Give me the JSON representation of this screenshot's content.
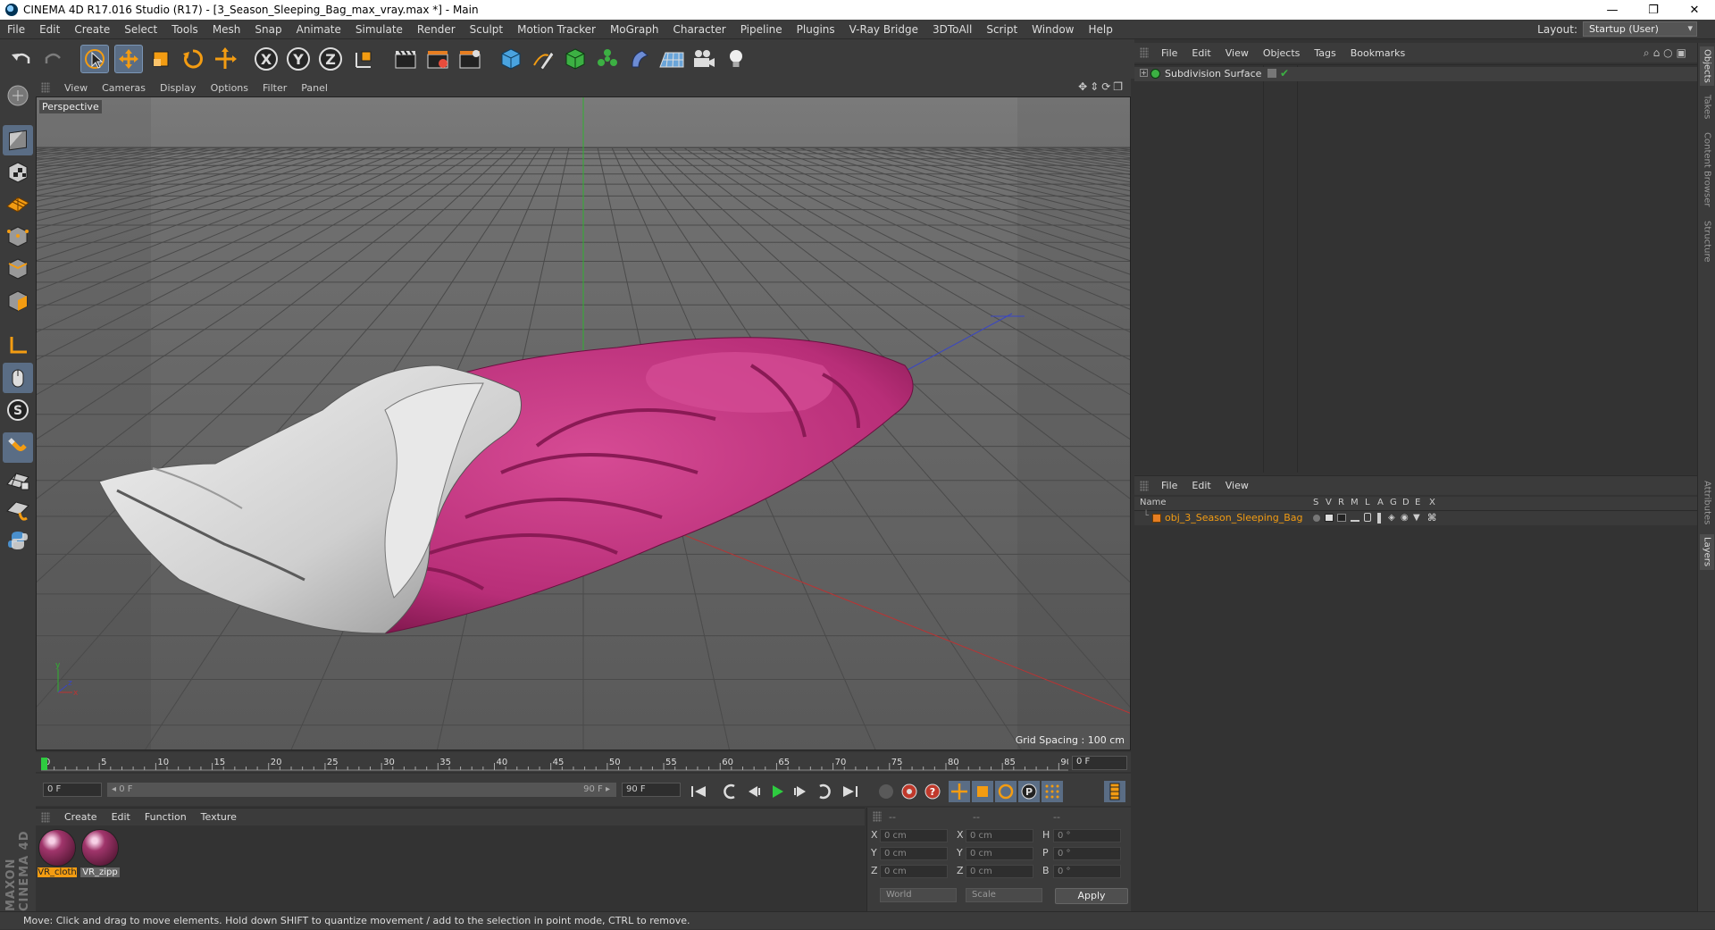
{
  "window": {
    "title": "CINEMA 4D R17.016 Studio (R17) - [3_Season_Sleeping_Bag_max_vray.max *] - Main",
    "controls": [
      "—",
      "❐",
      "✕"
    ]
  },
  "menubar": {
    "items": [
      "File",
      "Edit",
      "Create",
      "Select",
      "Tools",
      "Mesh",
      "Snap",
      "Animate",
      "Simulate",
      "Render",
      "Sculpt",
      "Motion Tracker",
      "MoGraph",
      "Character",
      "Pipeline",
      "Plugins",
      "V-Ray Bridge",
      "3DToAll",
      "Script",
      "Window",
      "Help"
    ],
    "layout_label": "Layout:",
    "layout_value": "Startup (User)"
  },
  "toolbar": {
    "axis_x": "X",
    "axis_y": "Y",
    "axis_z": "Z"
  },
  "viewport": {
    "menu": [
      "View",
      "Cameras",
      "Display",
      "Options",
      "Filter",
      "Panel"
    ],
    "camera_label": "Perspective",
    "grid_spacing": "Grid Spacing : 100 cm"
  },
  "timeline": {
    "ticks": [
      "0",
      "5",
      "10",
      "15",
      "20",
      "25",
      "30",
      "35",
      "40",
      "45",
      "50",
      "55",
      "60",
      "65",
      "70",
      "75",
      "80",
      "85",
      "90"
    ],
    "current_frame": "0 F",
    "start_field": "0 F",
    "range_start": "◂ 0 F",
    "range_end": "90 F ▸",
    "end_field": "90 F"
  },
  "material_panel": {
    "menu": [
      "Create",
      "Edit",
      "Function",
      "Texture"
    ],
    "materials": [
      {
        "name": "VR_cloth"
      },
      {
        "name": "VR_zipp"
      }
    ]
  },
  "coords": {
    "header": [
      "--",
      "--",
      "--"
    ],
    "rows": [
      {
        "axis": "X",
        "pos": "0 cm",
        "axis2": "X",
        "size": "0 cm",
        "rot_label": "H",
        "rot": "0 °"
      },
      {
        "axis": "Y",
        "pos": "0 cm",
        "axis2": "Y",
        "size": "0 cm",
        "rot_label": "P",
        "rot": "0 °"
      },
      {
        "axis": "Z",
        "pos": "0 cm",
        "axis2": "Z",
        "size": "0 cm",
        "rot_label": "B",
        "rot": "0 °"
      }
    ],
    "space": "World",
    "mode": "Scale",
    "apply": "Apply"
  },
  "objects_panel": {
    "menu": [
      "File",
      "Edit",
      "View",
      "Objects",
      "Tags",
      "Bookmarks"
    ],
    "object_name": "Subdivision Surface"
  },
  "layers_panel": {
    "menu": [
      "File",
      "Edit",
      "View"
    ],
    "columns": [
      "Name",
      "S",
      "V",
      "R",
      "M",
      "L",
      "A",
      "G",
      "D",
      "E",
      "X"
    ],
    "layer_name": "obj_3_Season_Sleeping_Bag"
  },
  "right_tabs": [
    "Objects",
    "Takes",
    "Content Browser",
    "Structure",
    "Attributes",
    "Layers"
  ],
  "status": {
    "text": "Move: Click and drag to move elements. Hold down SHIFT to quantize movement / add to the selection in point mode, CTRL to remove."
  },
  "branding": {
    "logo": "MAXON CINEMA 4D"
  },
  "colors": {
    "accent_orange": "#f39c12",
    "active_blue": "#5a6d85",
    "bag_pink": "#c2307a",
    "bag_white": "#d9d9d9"
  }
}
